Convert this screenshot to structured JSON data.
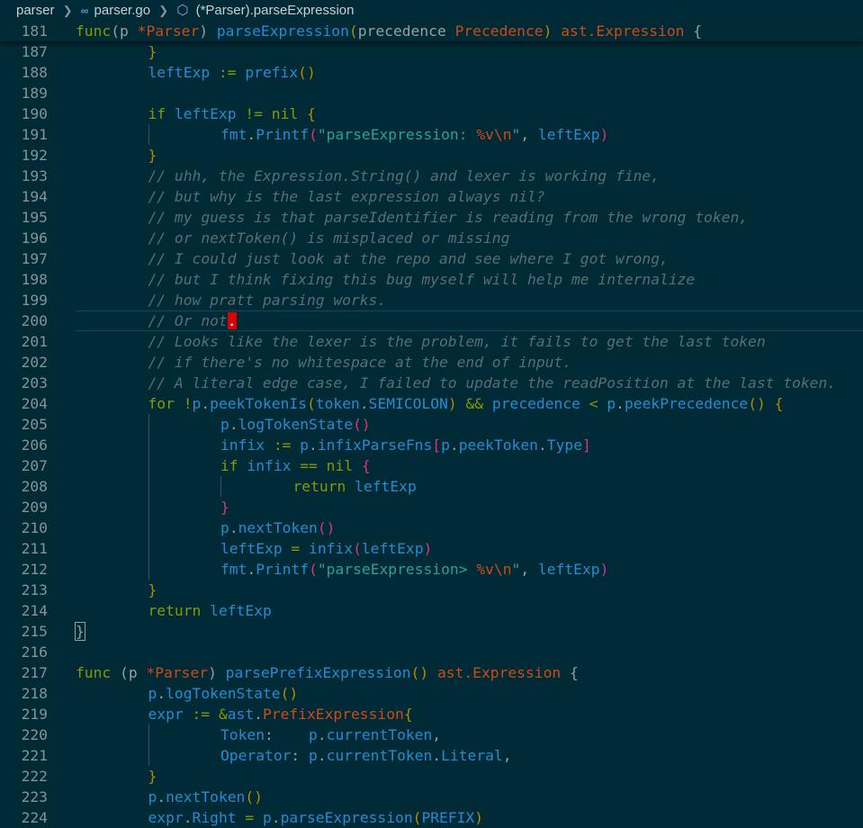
{
  "breadcrumb": {
    "folder": "parser",
    "file": "parser.go",
    "symbol": "(*Parser).parseExpression"
  },
  "editor": {
    "cursor_line": 200,
    "sticky_line": {
      "n": 181,
      "indent": 0,
      "tokens": [
        [
          "kw",
          "func"
        ],
        [
          "",
          ""
        ],
        [
          "",
          "(p "
        ],
        [
          "tp",
          "*Parser"
        ],
        [
          "",
          ") "
        ],
        [
          "fn",
          "parseExpression"
        ],
        [
          "pn",
          "("
        ],
        [
          "",
          "precedence "
        ],
        [
          "tp",
          "Precedence"
        ],
        [
          "pn",
          ")"
        ],
        [
          "",
          " "
        ],
        [
          "tp",
          "ast.Expression"
        ],
        [
          "",
          " {"
        ]
      ]
    },
    "lines": [
      {
        "n": 187,
        "indent": 1,
        "tokens": [
          [
            "pn",
            "}"
          ]
        ]
      },
      {
        "n": 188,
        "indent": 1,
        "tokens": [
          [
            "fn",
            "leftExp"
          ],
          [
            "op",
            " := "
          ],
          [
            "fn",
            "prefix"
          ],
          [
            "pn",
            "()"
          ]
        ]
      },
      {
        "n": 189,
        "indent": 0,
        "tokens": []
      },
      {
        "n": 190,
        "indent": 1,
        "tokens": [
          [
            "kw",
            "if"
          ],
          [
            "",
            " "
          ],
          [
            "fn",
            "leftExp"
          ],
          [
            "op",
            " != "
          ],
          [
            "kw",
            "nil"
          ],
          [
            "",
            " "
          ],
          [
            "pn",
            "{"
          ]
        ]
      },
      {
        "n": 191,
        "indent": 2,
        "tokens": [
          [
            "fn",
            "fmt"
          ],
          [
            "",
            "."
          ],
          [
            "fn",
            "Printf"
          ],
          [
            "pn2",
            "("
          ],
          [
            "st",
            "\"parseExpression: "
          ],
          [
            "tp",
            "%v\\n"
          ],
          [
            "st",
            "\""
          ],
          [
            "",
            ", "
          ],
          [
            "fn",
            "leftExp"
          ],
          [
            "pn2",
            ")"
          ]
        ]
      },
      {
        "n": 192,
        "indent": 1,
        "tokens": [
          [
            "pn",
            "}"
          ]
        ]
      },
      {
        "n": 193,
        "indent": 1,
        "tokens": [
          [
            "cm",
            "// uhh, the Expression.String() and lexer is working fine,"
          ]
        ]
      },
      {
        "n": 194,
        "indent": 1,
        "tokens": [
          [
            "cm",
            "// but why is the last expression always nil?"
          ]
        ]
      },
      {
        "n": 195,
        "indent": 1,
        "tokens": [
          [
            "cm",
            "// my guess is that parseIdentifier is reading from the wrong token,"
          ]
        ]
      },
      {
        "n": 196,
        "indent": 1,
        "tokens": [
          [
            "cm",
            "// or nextToken() is misplaced or missing"
          ]
        ]
      },
      {
        "n": 197,
        "indent": 1,
        "tokens": [
          [
            "cm",
            "// I could just look at the repo and see where I got wrong,"
          ]
        ]
      },
      {
        "n": 198,
        "indent": 1,
        "tokens": [
          [
            "cm",
            "// but I think fixing this bug myself will help me internalize"
          ]
        ]
      },
      {
        "n": 199,
        "indent": 1,
        "tokens": [
          [
            "cm",
            "// how pratt parsing works."
          ]
        ]
      },
      {
        "n": 200,
        "indent": 1,
        "tokens": [
          [
            "cm",
            "// Or not"
          ],
          [
            "cursor",
            "."
          ]
        ]
      },
      {
        "n": 201,
        "indent": 1,
        "tokens": [
          [
            "cm",
            "// Looks like the lexer is the problem, it fails to get the last token"
          ]
        ]
      },
      {
        "n": 202,
        "indent": 1,
        "tokens": [
          [
            "cm",
            "// if there's no whitespace at the end of input."
          ]
        ]
      },
      {
        "n": 203,
        "indent": 1,
        "tokens": [
          [
            "cm",
            "// A literal edge case, I failed to update the readPosition at the last token."
          ]
        ]
      },
      {
        "n": 204,
        "indent": 1,
        "tokens": [
          [
            "kw",
            "for"
          ],
          [
            "",
            " "
          ],
          [
            "op",
            "!"
          ],
          [
            "fn",
            "p"
          ],
          [
            "",
            "."
          ],
          [
            "fn",
            "peekTokenIs"
          ],
          [
            "pn",
            "("
          ],
          [
            "fn",
            "token"
          ],
          [
            "",
            "."
          ],
          [
            "fn",
            "SEMICOLON"
          ],
          [
            "pn",
            ")"
          ],
          [
            "op",
            " && "
          ],
          [
            "fn",
            "precedence"
          ],
          [
            "op",
            " < "
          ],
          [
            "fn",
            "p"
          ],
          [
            "",
            "."
          ],
          [
            "fn",
            "peekPrecedence"
          ],
          [
            "pn",
            "()"
          ],
          [
            "",
            " "
          ],
          [
            "pn",
            "{"
          ]
        ]
      },
      {
        "n": 205,
        "indent": 2,
        "tokens": [
          [
            "fn",
            "p"
          ],
          [
            "",
            "."
          ],
          [
            "fn",
            "logTokenState"
          ],
          [
            "pn2",
            "()"
          ]
        ]
      },
      {
        "n": 206,
        "indent": 2,
        "tokens": [
          [
            "fn",
            "infix"
          ],
          [
            "op",
            " := "
          ],
          [
            "fn",
            "p"
          ],
          [
            "",
            "."
          ],
          [
            "fn",
            "infixParseFns"
          ],
          [
            "pn2",
            "["
          ],
          [
            "fn",
            "p"
          ],
          [
            "",
            "."
          ],
          [
            "fn",
            "peekToken"
          ],
          [
            "",
            "."
          ],
          [
            "fn",
            "Type"
          ],
          [
            "pn2",
            "]"
          ]
        ]
      },
      {
        "n": 207,
        "indent": 2,
        "tokens": [
          [
            "kw",
            "if"
          ],
          [
            "",
            " "
          ],
          [
            "fn",
            "infix"
          ],
          [
            "op",
            " == "
          ],
          [
            "kw",
            "nil"
          ],
          [
            "",
            " "
          ],
          [
            "pn2",
            "{"
          ]
        ]
      },
      {
        "n": 208,
        "indent": 3,
        "tokens": [
          [
            "kw",
            "return"
          ],
          [
            "",
            " "
          ],
          [
            "fn",
            "leftExp"
          ]
        ]
      },
      {
        "n": 209,
        "indent": 2,
        "tokens": [
          [
            "pn2",
            "}"
          ]
        ]
      },
      {
        "n": 210,
        "indent": 2,
        "tokens": [
          [
            "fn",
            "p"
          ],
          [
            "",
            "."
          ],
          [
            "fn",
            "nextToken"
          ],
          [
            "pn2",
            "()"
          ]
        ]
      },
      {
        "n": 211,
        "indent": 2,
        "tokens": [
          [
            "fn",
            "leftExp"
          ],
          [
            "op",
            " = "
          ],
          [
            "fn",
            "infix"
          ],
          [
            "pn2",
            "("
          ],
          [
            "fn",
            "leftExp"
          ],
          [
            "pn2",
            ")"
          ]
        ]
      },
      {
        "n": 212,
        "indent": 2,
        "tokens": [
          [
            "fn",
            "fmt"
          ],
          [
            "",
            "."
          ],
          [
            "fn",
            "Printf"
          ],
          [
            "pn2",
            "("
          ],
          [
            "st",
            "\"parseExpression> "
          ],
          [
            "tp",
            "%v\\n"
          ],
          [
            "st",
            "\""
          ],
          [
            "",
            ", "
          ],
          [
            "fn",
            "leftExp"
          ],
          [
            "pn2",
            ")"
          ]
        ]
      },
      {
        "n": 213,
        "indent": 1,
        "tokens": [
          [
            "pn",
            "}"
          ]
        ]
      },
      {
        "n": 214,
        "indent": 1,
        "tokens": [
          [
            "kw",
            "return"
          ],
          [
            "",
            " "
          ],
          [
            "fn",
            "leftExp"
          ]
        ]
      },
      {
        "n": 215,
        "indent": 0,
        "tokens": [
          [
            "bracket",
            "}"
          ]
        ]
      },
      {
        "n": 216,
        "indent": 0,
        "tokens": []
      },
      {
        "n": 217,
        "indent": 0,
        "tokens": [
          [
            "kw",
            "func"
          ],
          [
            "",
            " (p "
          ],
          [
            "tp",
            "*Parser"
          ],
          [
            "",
            ") "
          ],
          [
            "fn",
            "parsePrefixExpression"
          ],
          [
            "pn",
            "()"
          ],
          [
            "",
            " "
          ],
          [
            "tp",
            "ast.Expression"
          ],
          [
            "",
            " {"
          ]
        ]
      },
      {
        "n": 218,
        "indent": 1,
        "tokens": [
          [
            "fn",
            "p"
          ],
          [
            "",
            "."
          ],
          [
            "fn",
            "logTokenState"
          ],
          [
            "pn",
            "()"
          ]
        ]
      },
      {
        "n": 219,
        "indent": 1,
        "tokens": [
          [
            "fn",
            "expr"
          ],
          [
            "op",
            " := "
          ],
          [
            "op",
            "&"
          ],
          [
            "fn",
            "ast"
          ],
          [
            "",
            "."
          ],
          [
            "tp",
            "PrefixExpression"
          ],
          [
            "pn",
            "{"
          ]
        ]
      },
      {
        "n": 220,
        "indent": 2,
        "tokens": [
          [
            "fn",
            "Token"
          ],
          [
            "",
            ":    "
          ],
          [
            "fn",
            "p"
          ],
          [
            "",
            "."
          ],
          [
            "fn",
            "currentToken"
          ],
          [
            "",
            ","
          ]
        ]
      },
      {
        "n": 221,
        "indent": 2,
        "tokens": [
          [
            "fn",
            "Operator"
          ],
          [
            "",
            ": "
          ],
          [
            "fn",
            "p"
          ],
          [
            "",
            "."
          ],
          [
            "fn",
            "currentToken"
          ],
          [
            "",
            "."
          ],
          [
            "fn",
            "Literal"
          ],
          [
            "",
            ","
          ]
        ]
      },
      {
        "n": 222,
        "indent": 1,
        "tokens": [
          [
            "pn",
            "}"
          ]
        ]
      },
      {
        "n": 223,
        "indent": 1,
        "tokens": [
          [
            "fn",
            "p"
          ],
          [
            "",
            "."
          ],
          [
            "fn",
            "nextToken"
          ],
          [
            "pn",
            "()"
          ]
        ]
      },
      {
        "n": 224,
        "indent": 1,
        "tokens": [
          [
            "fn",
            "expr"
          ],
          [
            "",
            "."
          ],
          [
            "fn",
            "Right"
          ],
          [
            "op",
            " = "
          ],
          [
            "fn",
            "p"
          ],
          [
            "",
            "."
          ],
          [
            "fn",
            "parseExpression"
          ],
          [
            "pn",
            "("
          ],
          [
            "fn",
            "PREFIX"
          ],
          [
            "pn",
            ")"
          ]
        ]
      }
    ]
  }
}
